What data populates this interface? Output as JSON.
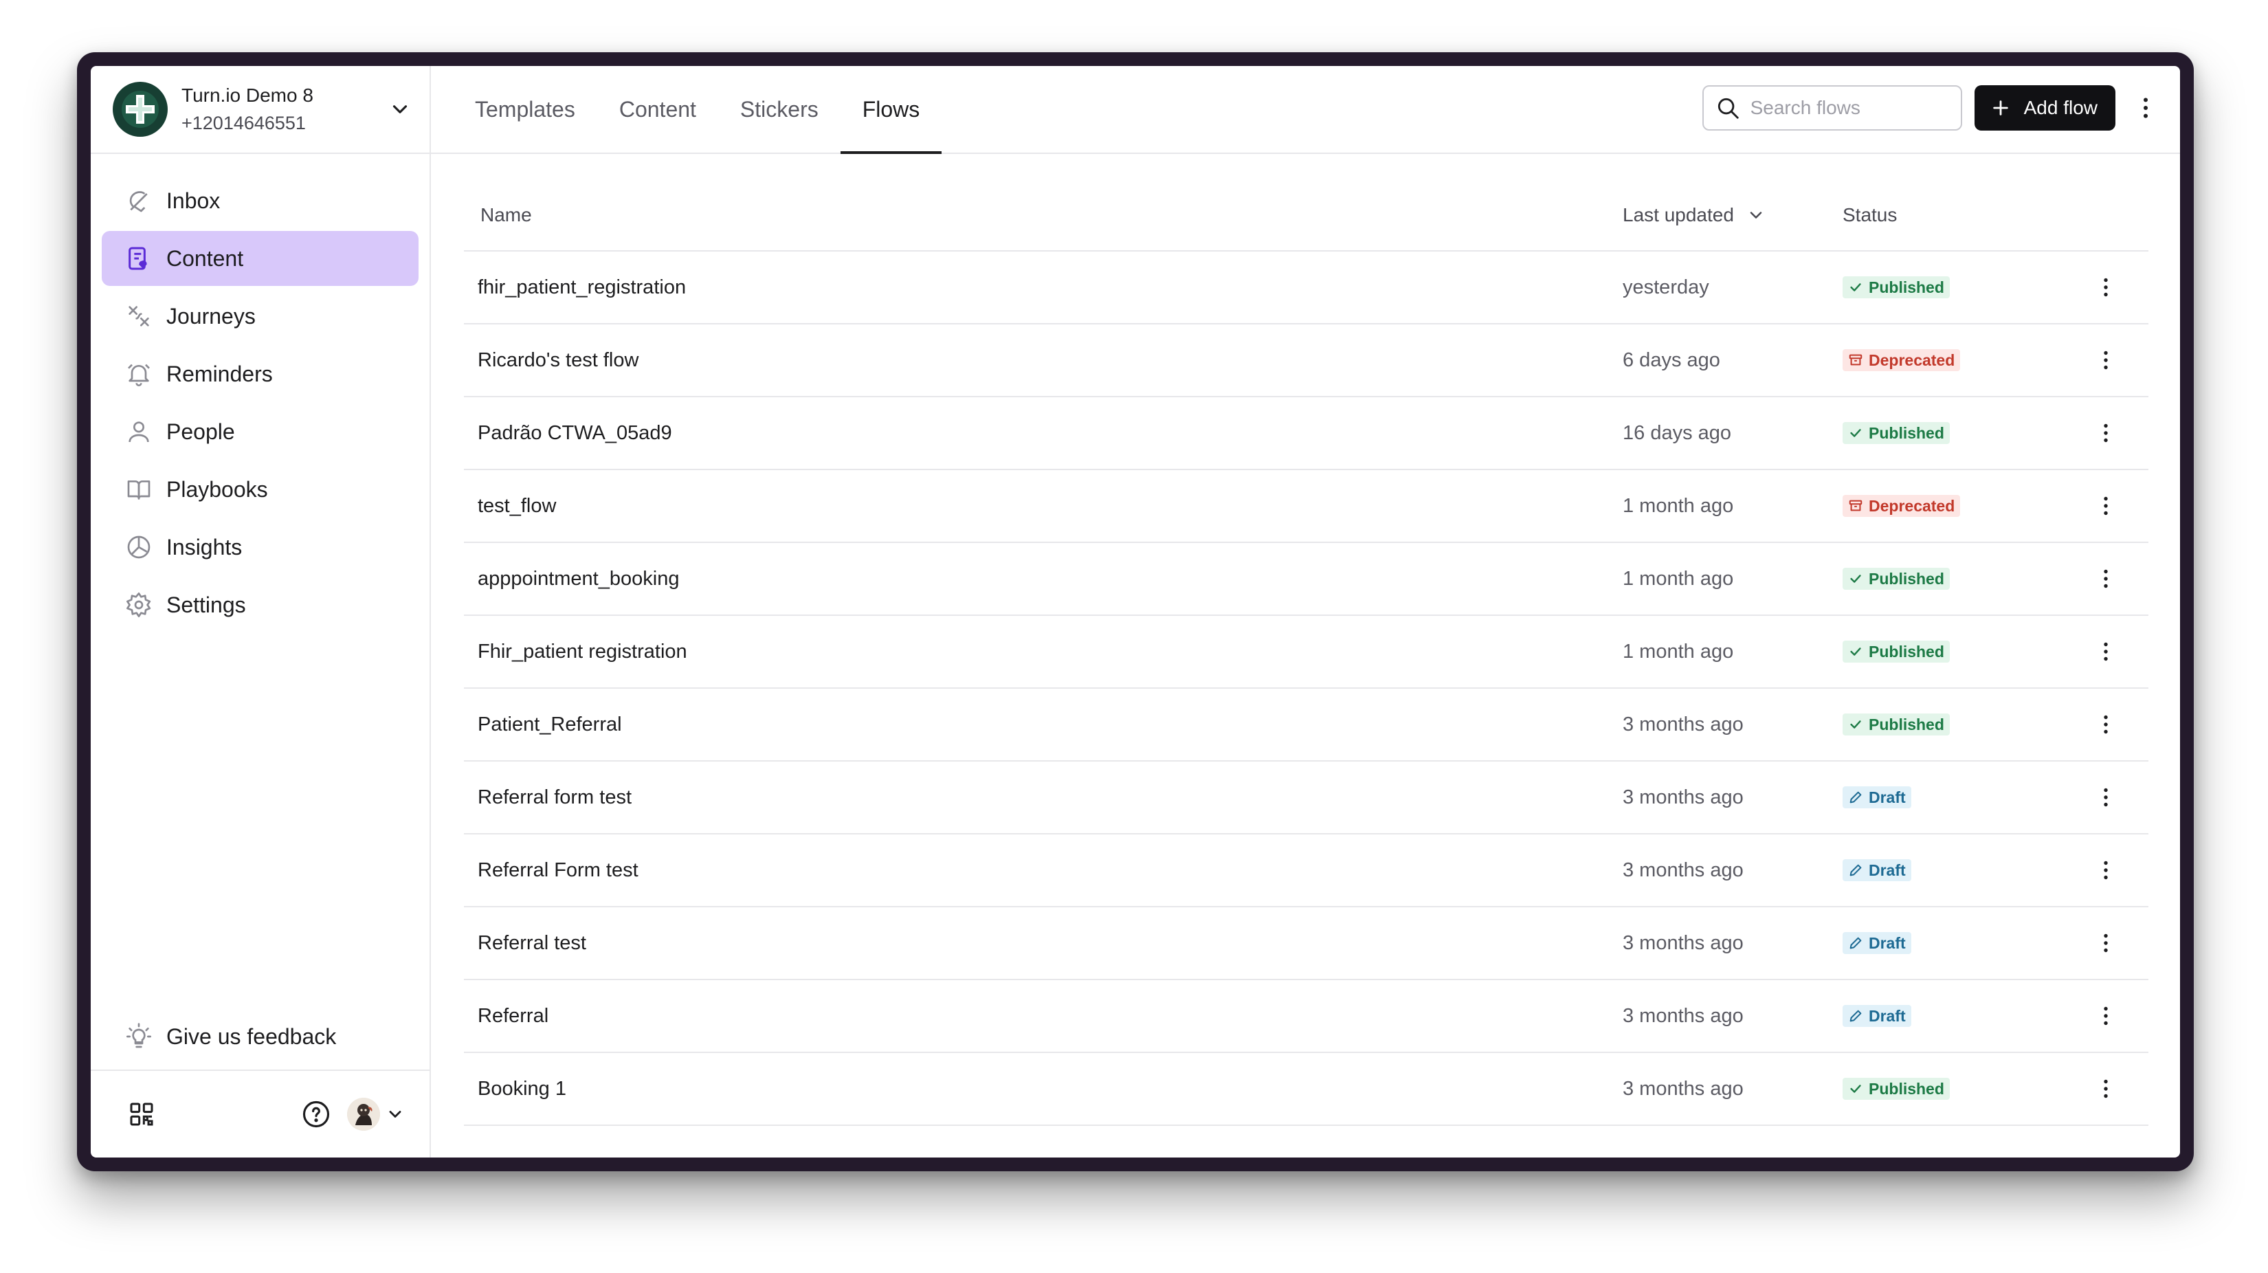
{
  "account": {
    "name": "Turn.io Demo 8",
    "phone": "+12014646551"
  },
  "nav": [
    {
      "label": "Inbox",
      "icon": "bell-icon"
    },
    {
      "label": "Content",
      "icon": "content-icon",
      "active": true
    },
    {
      "label": "Journeys",
      "icon": "journeys-icon"
    },
    {
      "label": "Reminders",
      "icon": "reminders-icon"
    },
    {
      "label": "People",
      "icon": "person-icon"
    },
    {
      "label": "Playbooks",
      "icon": "book-icon"
    },
    {
      "label": "Insights",
      "icon": "insights-icon"
    },
    {
      "label": "Settings",
      "icon": "gear-icon"
    }
  ],
  "feedback_label": "Give us feedback",
  "tabs": [
    {
      "label": "Templates"
    },
    {
      "label": "Content"
    },
    {
      "label": "Stickers"
    },
    {
      "label": "Flows",
      "active": true
    }
  ],
  "search": {
    "placeholder": "Search flows",
    "value": ""
  },
  "add_button_label": "Add flow",
  "table": {
    "headers": {
      "name": "Name",
      "updated": "Last updated",
      "status": "Status"
    },
    "rows": [
      {
        "name": "fhir_patient_registration",
        "updated": "yesterday",
        "status": "Published"
      },
      {
        "name": "Ricardo's test flow",
        "updated": "6 days ago",
        "status": "Deprecated"
      },
      {
        "name": "Padrão CTWA_05ad9",
        "updated": "16 days ago",
        "status": "Published"
      },
      {
        "name": "test_flow",
        "updated": "1 month ago",
        "status": "Deprecated"
      },
      {
        "name": "apppointment_booking",
        "updated": "1 month ago",
        "status": "Published"
      },
      {
        "name": "Fhir_patient registration",
        "updated": "1 month ago",
        "status": "Published"
      },
      {
        "name": "Patient_Referral",
        "updated": "3 months ago",
        "status": "Published"
      },
      {
        "name": "Referral form test",
        "updated": "3 months ago",
        "status": "Draft"
      },
      {
        "name": "Referral Form test",
        "updated": "3 months ago",
        "status": "Draft"
      },
      {
        "name": "Referral test",
        "updated": "3 months ago",
        "status": "Draft"
      },
      {
        "name": "Referral",
        "updated": "3 months ago",
        "status": "Draft"
      },
      {
        "name": "Booking 1",
        "updated": "3 months ago",
        "status": "Published"
      }
    ]
  },
  "colors": {
    "accent_active_nav": "#d8c8fa",
    "published_bg": "#e3f5ea",
    "published_fg": "#1c7a45",
    "deprecated_bg": "#fde6e4",
    "deprecated_fg": "#c2392b",
    "draft_bg": "#e1f1f9",
    "draft_fg": "#1d6a93",
    "button_bg": "#111114"
  }
}
